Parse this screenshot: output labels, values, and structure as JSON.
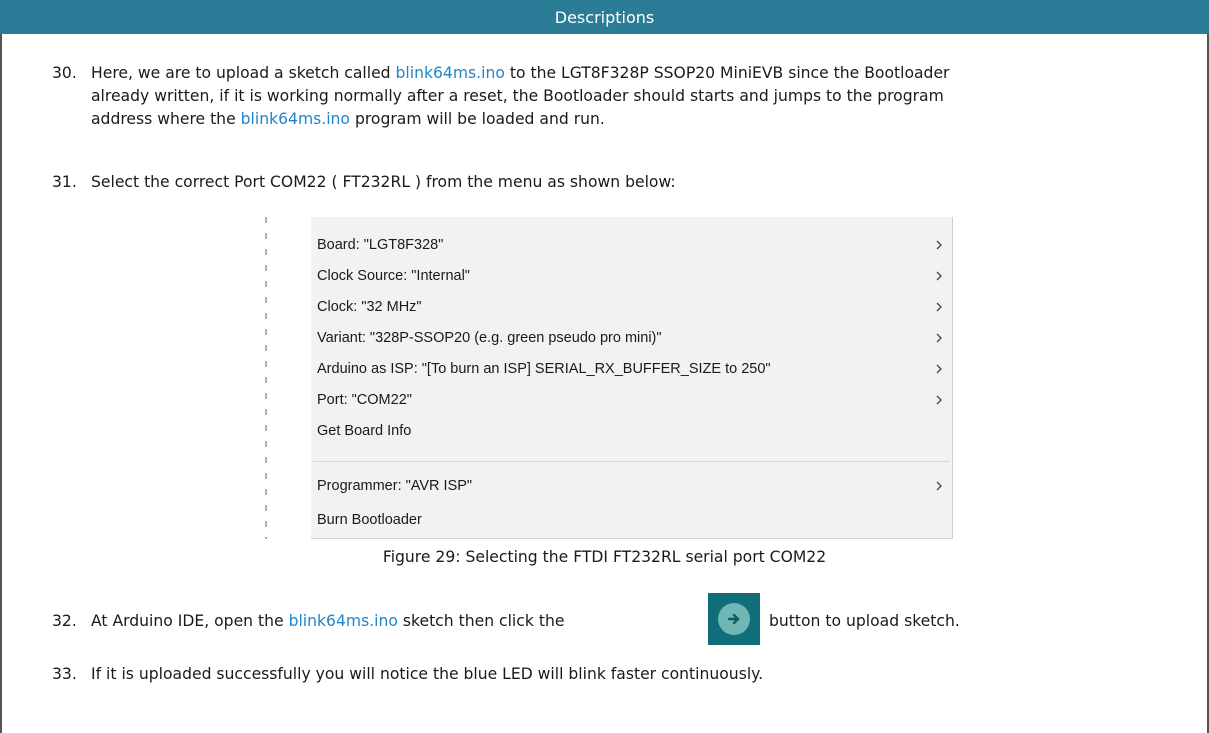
{
  "header": {
    "title": "Descriptions"
  },
  "steps": {
    "s30": {
      "num": "30.",
      "t1": "Here, we are to upload a sketch called ",
      "link1": "blink64ms.ino",
      "t2": " to the LGT8F328P SSOP20 MiniEVB since the Bootloader",
      "line2": "already written, if it is working normally after a reset, the Bootloader should starts and jumps to the program",
      "t3": "address where the ",
      "link2": "blink64ms.ino",
      "t4": " program will be loaded and run."
    },
    "s31": {
      "num": "31.",
      "text": "Select the correct Port COM22 ( FT232RL ) from the menu as shown below:"
    },
    "s32": {
      "num": "32.",
      "t1": "At Arduino IDE, open the ",
      "link": "blink64ms.ino",
      "t2": " sketch then click the",
      "t3": "button to upload sketch."
    },
    "s33": {
      "num": "33.",
      "text": "If it is uploaded successfully you will notice the blue LED will blink faster continuously."
    }
  },
  "menu": {
    "items": [
      {
        "label": "Board: \"LGT8F328\"",
        "submenu": true
      },
      {
        "label": "Clock Source: \"Internal\"",
        "submenu": true
      },
      {
        "label": "Clock: \"32 MHz\"",
        "submenu": true
      },
      {
        "label": "Variant: \"328P-SSOP20 (e.g. green pseudo pro mini)\"",
        "submenu": true
      },
      {
        "label": "Arduino as ISP: \"[To burn an ISP] SERIAL_RX_BUFFER_SIZE to 250\"",
        "submenu": true
      },
      {
        "label": "Port: \"COM22\"",
        "submenu": true
      },
      {
        "label": "Get Board Info",
        "submenu": false
      },
      {
        "label": "Programmer: \"AVR ISP\"",
        "submenu": true
      },
      {
        "label": "Burn Bootloader",
        "submenu": false
      }
    ]
  },
  "caption": "Figure 29: Selecting the FTDI FT232RL serial port COM22",
  "colors": {
    "header_bg": "#2b7d97",
    "link": "#1e86cc",
    "upload_button": "#0f6e7a"
  },
  "icons": {
    "upload": "arrow-right-circle-icon",
    "submenu": "chevron-right-icon"
  }
}
